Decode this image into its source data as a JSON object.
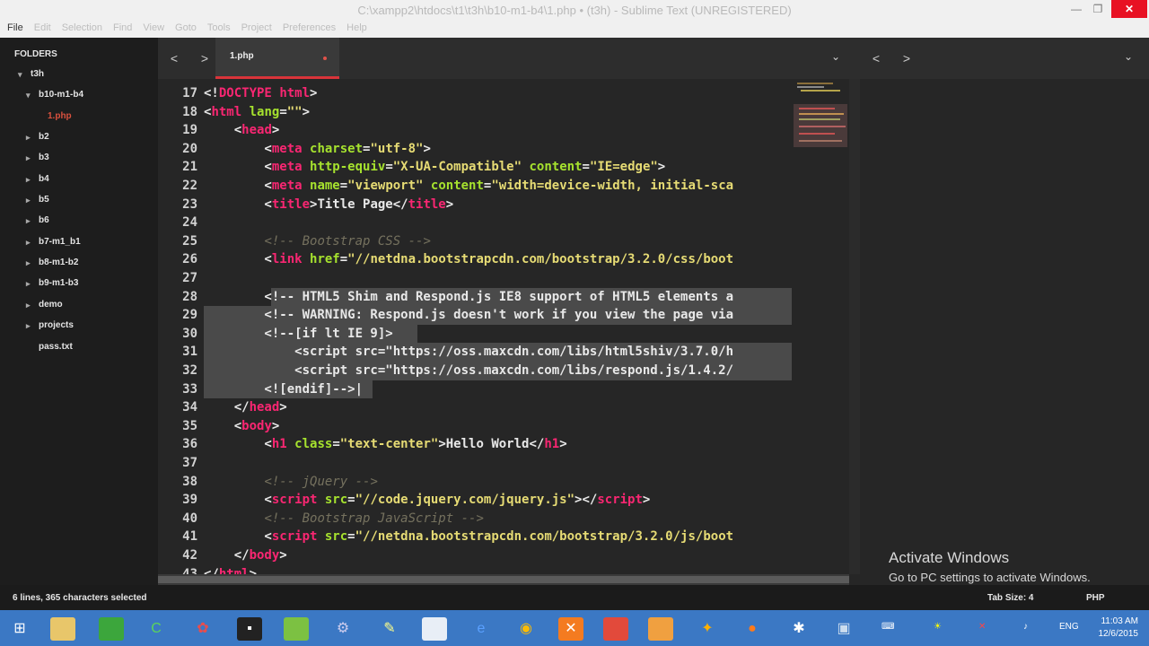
{
  "window": {
    "title": "C:\\xampp2\\htdocs\\t1\\t3h\\b10-m1-b4\\1.php • (t3h) - Sublime Text (UNREGISTERED)",
    "min_glyph": "—",
    "max_glyph": "❐",
    "close_glyph": "✕"
  },
  "menu": [
    "File",
    "Edit",
    "Selection",
    "Find",
    "View",
    "Goto",
    "Tools",
    "Project",
    "Preferences",
    "Help"
  ],
  "sidebar": {
    "header": "FOLDERS",
    "root": "t3h",
    "open_folder": "b10-m1-b4",
    "active_file": "1.php",
    "folders": [
      "b2",
      "b3",
      "b4",
      "b5",
      "b6",
      "b7-m1_b1",
      "b8-m1-b2",
      "b9-m1-b3",
      "demo",
      "projects"
    ],
    "files": [
      "pass.txt"
    ]
  },
  "tabs": {
    "active_tab": "1.php",
    "nav_back": "<",
    "nav_forward": ">",
    "dropdown": "⌄"
  },
  "editor": {
    "line_numbers": [
      "17",
      "18",
      "19",
      "20",
      "21",
      "22",
      "23",
      "24",
      "25",
      "26",
      "27",
      "28",
      "29",
      "30",
      "31",
      "32",
      "33",
      "34",
      "35",
      "36",
      "37",
      "38",
      "39",
      "40",
      "41",
      "42",
      "43"
    ]
  },
  "activate_windows": {
    "title": "Activate Windows",
    "subtitle": "Go to PC settings to activate Windows."
  },
  "status": {
    "selection": "6 lines, 365 characters selected",
    "tab_size": "Tab Size: 4",
    "syntax": "PHP"
  },
  "taskbar": {
    "lang": "ENG",
    "time": "11:03 AM",
    "date": "12/6/2015"
  },
  "colors": {
    "accent_tab": "#d9343a",
    "tag": "#f92672",
    "attribute": "#a6e22e",
    "string": "#e6db74",
    "comment": "#75715e",
    "taskbar": "#3b78c4"
  }
}
